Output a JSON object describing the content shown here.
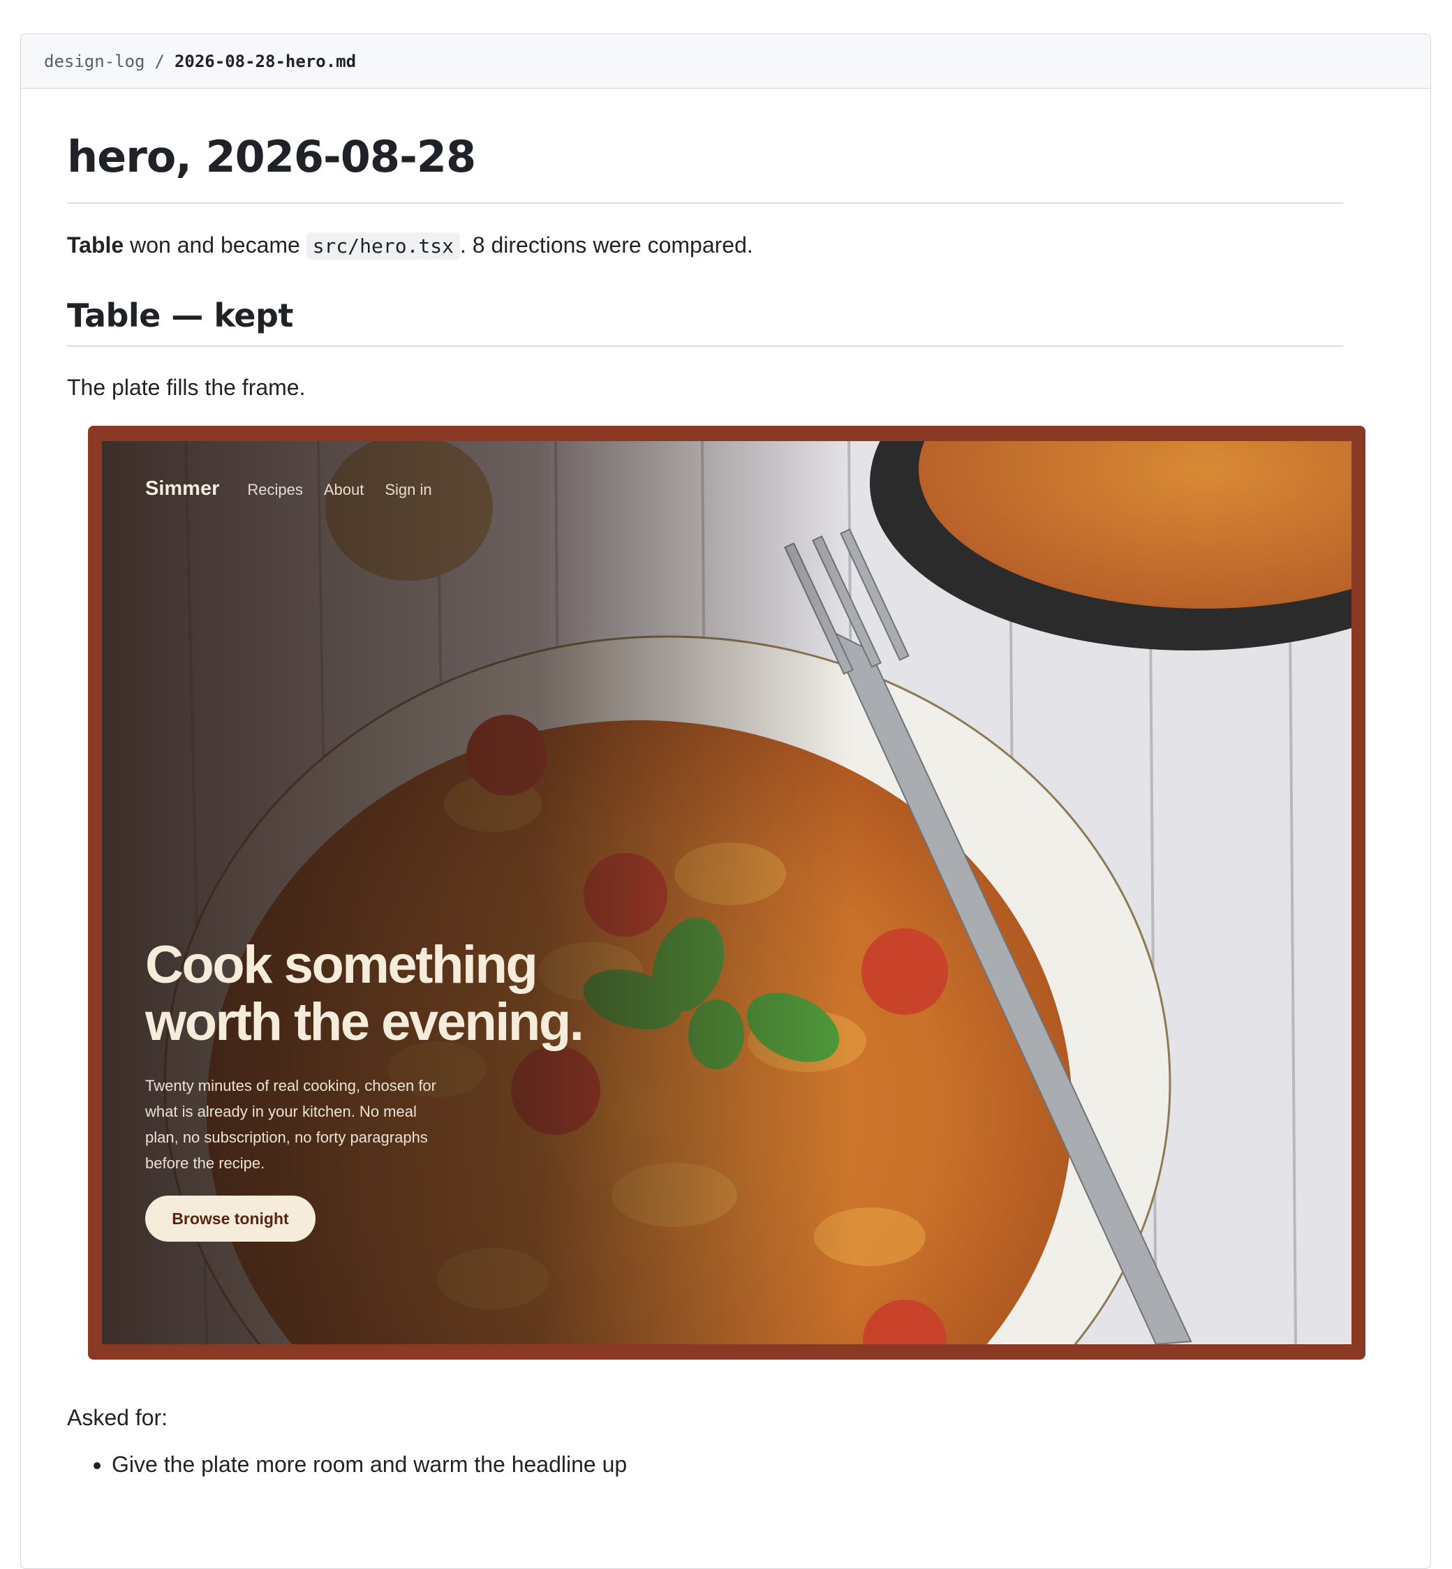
{
  "breadcrumb": {
    "folder": "design-log",
    "separator": "/",
    "file": "2026-08-28-hero.md"
  },
  "doc": {
    "title": "hero, 2026-08-28",
    "summary": {
      "winner": "Table",
      "text_1": " won and became ",
      "code": "src/hero.tsx",
      "text_2": ". 8 directions were compared."
    },
    "section_title": "Table — kept",
    "section_text": "The plate fills the frame.",
    "asked_for_label": "Asked for:",
    "asks": [
      "Give the plate more room and warm the headline up"
    ]
  },
  "hero_preview": {
    "brand": "Simmer",
    "nav": [
      "Recipes",
      "About",
      "Sign in"
    ],
    "headline": "Cook something\nworth the evening.",
    "subtext": "Twenty minutes of real cooking, chosen for what is already in your kitchen. No meal plan, no subscription, no forty paragraphs before the recipe.",
    "cta": "Browse tonight",
    "colors": {
      "frame": "#8a3a24",
      "headline": "#f6ecdc",
      "cta_bg": "#f6ecdc",
      "cta_text": "#5a2414"
    }
  }
}
